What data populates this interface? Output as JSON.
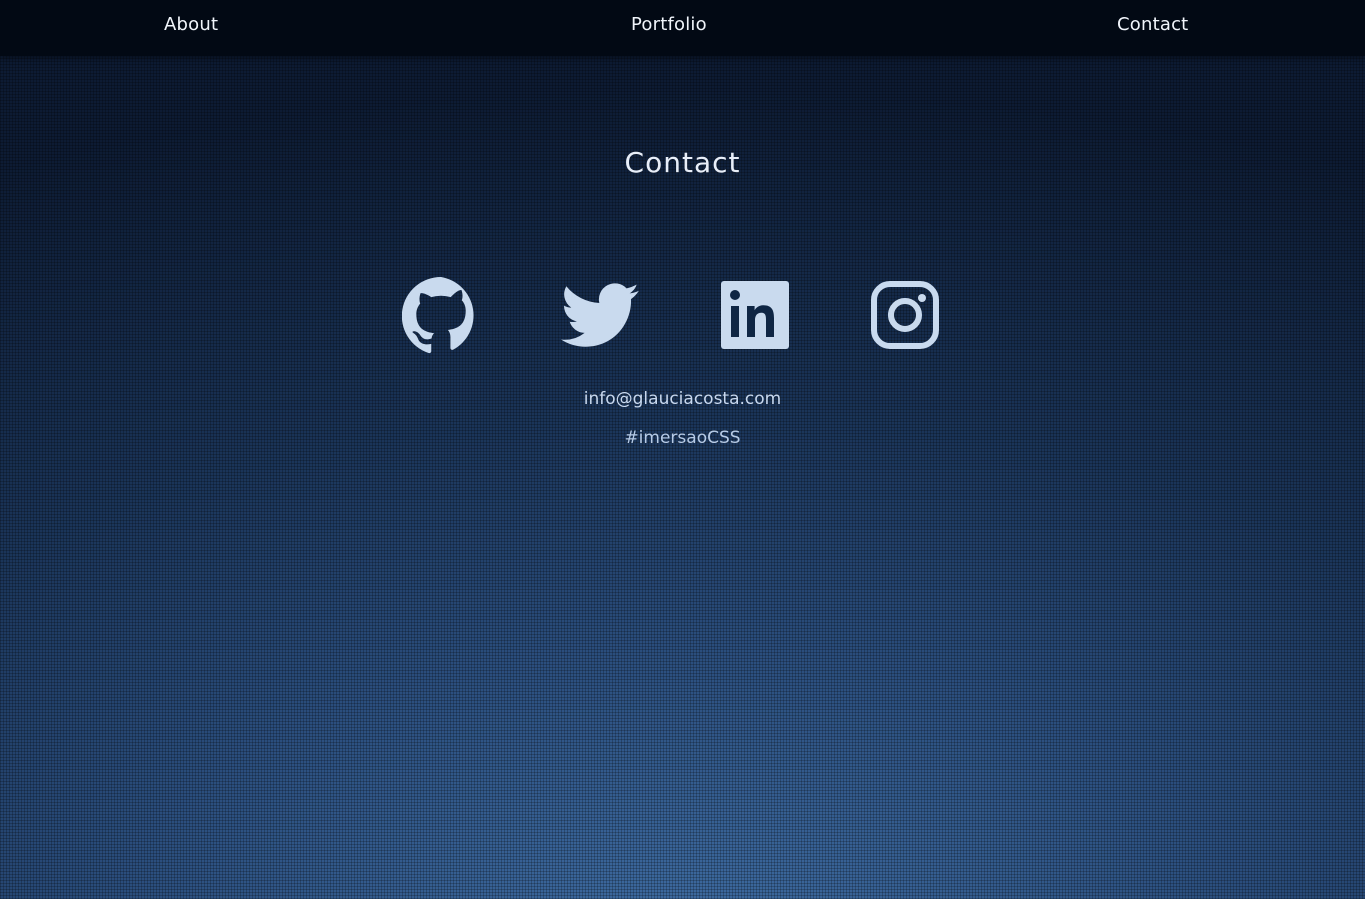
{
  "nav": {
    "about": "About",
    "portfolio": "Portfolio",
    "contact": "Contact"
  },
  "contact": {
    "title": "Contact",
    "social": [
      {
        "icon": "github-icon"
      },
      {
        "icon": "twitter-icon"
      },
      {
        "icon": "linkedin-icon"
      },
      {
        "icon": "instagram-icon"
      }
    ],
    "email": "info@glauciacosta.com",
    "hashtag": "#imersaoCSS"
  },
  "colors": {
    "nav_bg": "#020914",
    "icon": "#c9daee",
    "text": "#e8eef8"
  }
}
